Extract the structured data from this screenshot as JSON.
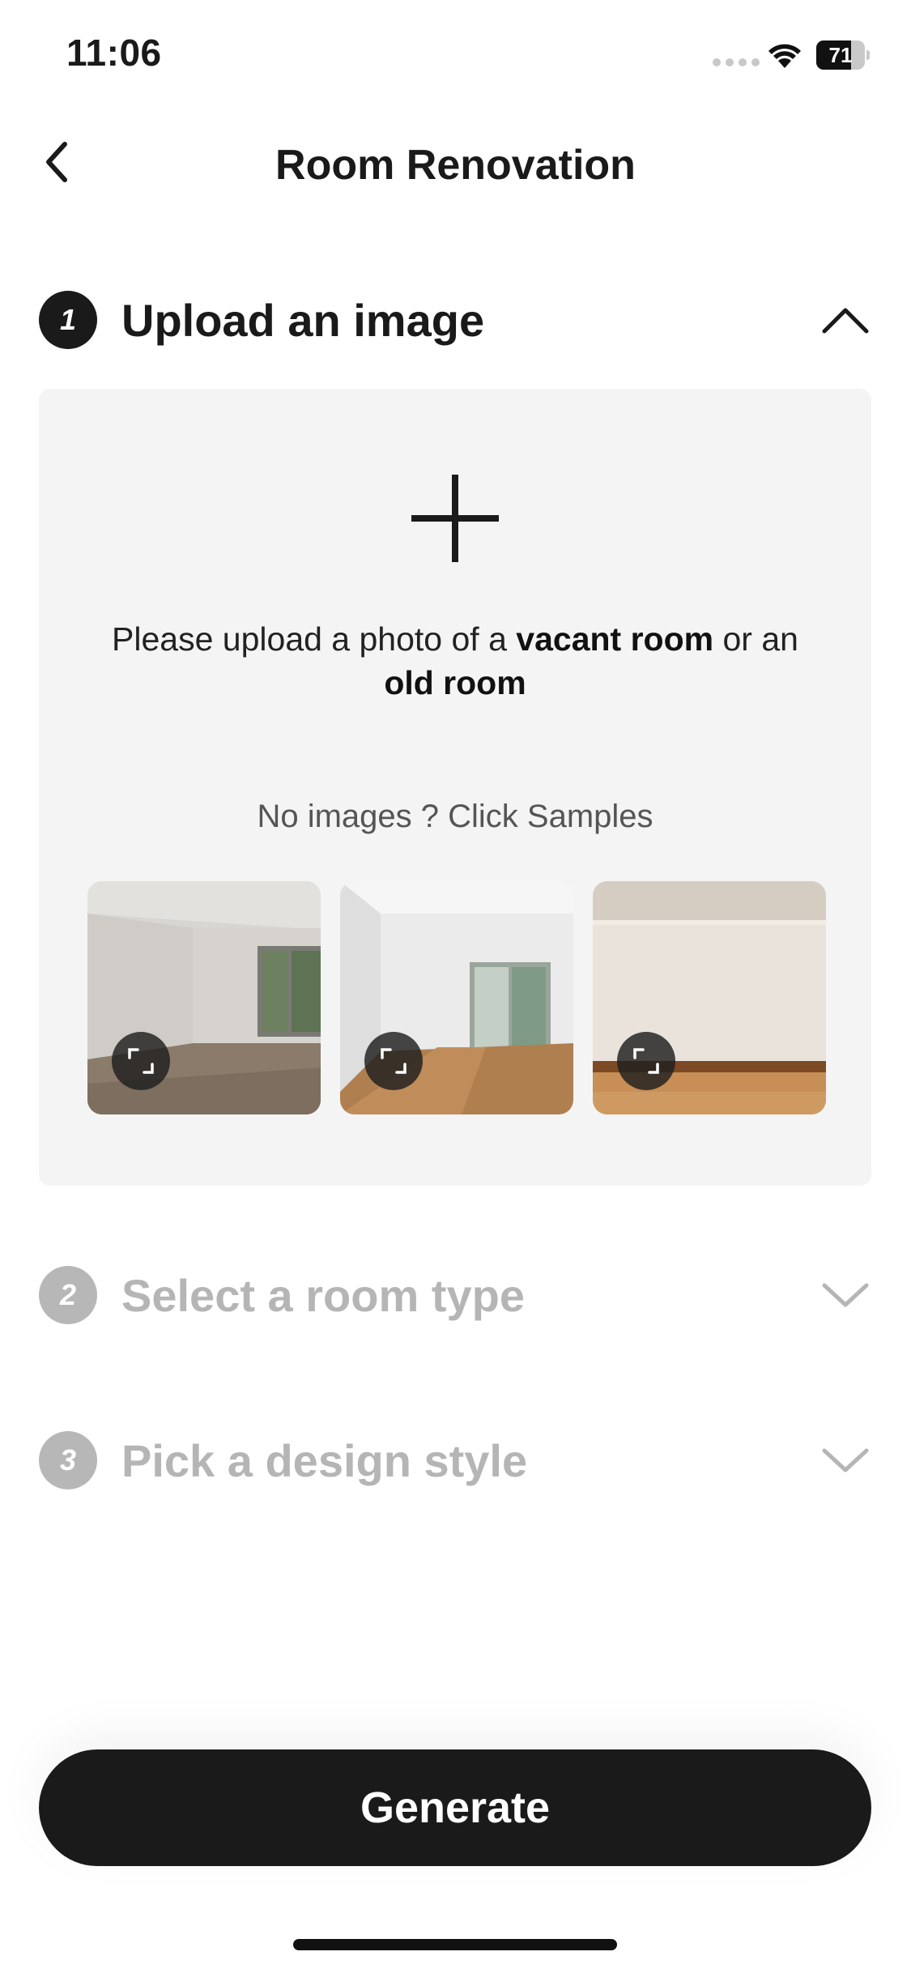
{
  "status_bar": {
    "time": "11:06",
    "battery_level": "71"
  },
  "header": {
    "title": "Room Renovation"
  },
  "steps": [
    {
      "number": "1",
      "title": "Upload an image",
      "state": "expanded"
    },
    {
      "number": "2",
      "title": "Select a room type",
      "state": "collapsed"
    },
    {
      "number": "3",
      "title": "Pick a design style",
      "state": "collapsed"
    }
  ],
  "upload": {
    "instruction_prefix": "Please upload a photo of a ",
    "instruction_bold_1": "vacant room",
    "instruction_middle": " or an ",
    "instruction_bold_2": "old room",
    "samples_hint": "No images ? Click Samples",
    "samples": [
      {
        "name": "sample-room-1",
        "icon": "expand-icon"
      },
      {
        "name": "sample-room-2",
        "icon": "expand-icon"
      },
      {
        "name": "sample-room-3",
        "icon": "expand-icon"
      }
    ]
  },
  "actions": {
    "generate_label": "Generate"
  },
  "colors": {
    "primary": "#1a1a1a",
    "inactive": "#b5b5b5",
    "panel": "#f4f4f4"
  }
}
